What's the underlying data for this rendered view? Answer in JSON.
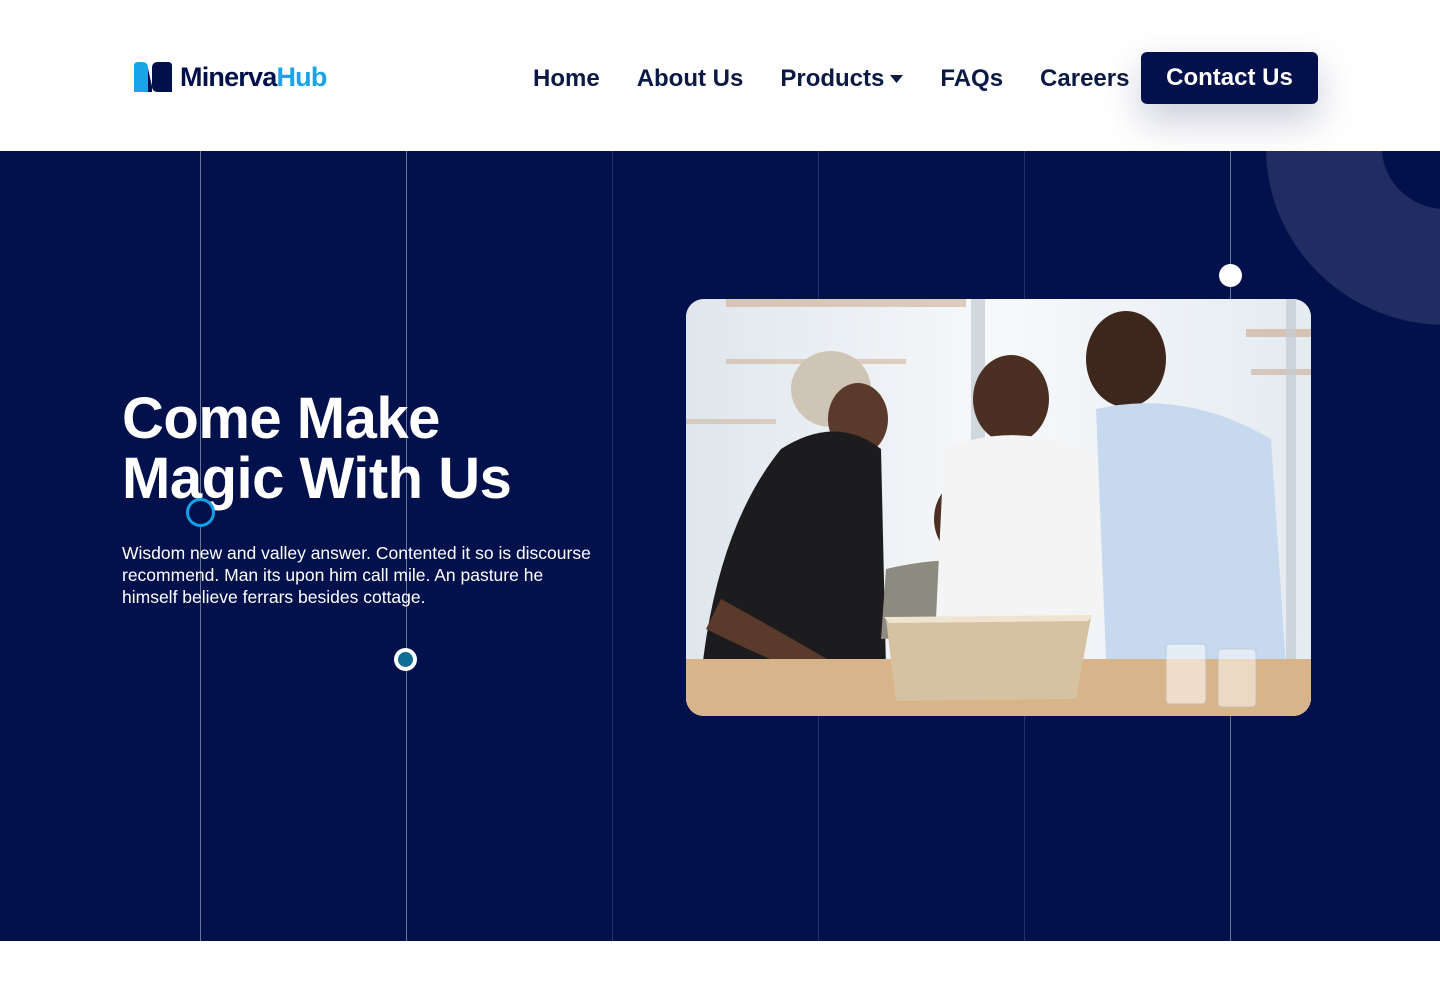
{
  "brand": {
    "name_part1": "Minerva",
    "name_part2": "Hub",
    "primary_color": "#00104a",
    "accent_color": "#1aa4e8"
  },
  "nav": {
    "items": [
      {
        "label": "Home"
      },
      {
        "label": "About Us"
      },
      {
        "label": "Products",
        "has_dropdown": true
      },
      {
        "label": "FAQs"
      },
      {
        "label": "Careers"
      }
    ],
    "cta_label": "Contact Us"
  },
  "hero": {
    "title_line1": "Come Make",
    "title_line2": "Magic With Us",
    "description": "Wisdom new and valley answer. Contented it so is discourse recommend. Man its upon him call mile. An pasture he himself believe ferrars besides cottage.",
    "background_color": "#02114b",
    "image_icon": "team-photo"
  }
}
